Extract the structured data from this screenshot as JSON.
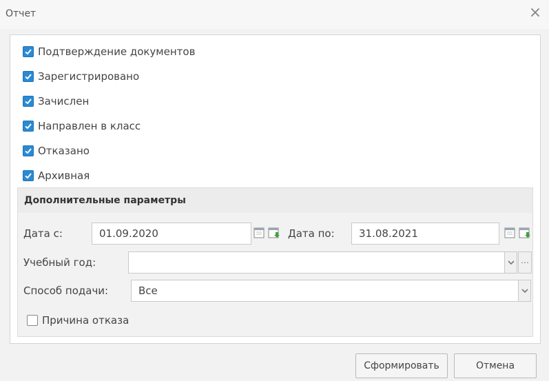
{
  "window": {
    "title": "Отчет",
    "close_label": "×"
  },
  "statuses": [
    {
      "label": "Подтверждение документов",
      "checked": true
    },
    {
      "label": "Зарегистрировано",
      "checked": true
    },
    {
      "label": "Зачислен",
      "checked": true
    },
    {
      "label": "Направлен в класс",
      "checked": true
    },
    {
      "label": "Отказано",
      "checked": true
    },
    {
      "label": "Архивная",
      "checked": true
    }
  ],
  "additional": {
    "title": "Дополнительные параметры",
    "date_from_label": "Дата с:",
    "date_from_value": "01.09.2020",
    "date_to_label": "Дата по:",
    "date_to_value": "31.08.2021",
    "school_year_label": "Учебный год:",
    "school_year_value": "",
    "submission_label": "Способ подачи:",
    "submission_value": "Все",
    "refusal_reason_label": "Причина отказа",
    "refusal_reason_checked": false
  },
  "buttons": {
    "generate": "Сформировать",
    "cancel": "Отмена"
  },
  "colors": {
    "checkbox_accent": "#2a8ad4",
    "calendar_icon_green": "#3aa33a"
  }
}
